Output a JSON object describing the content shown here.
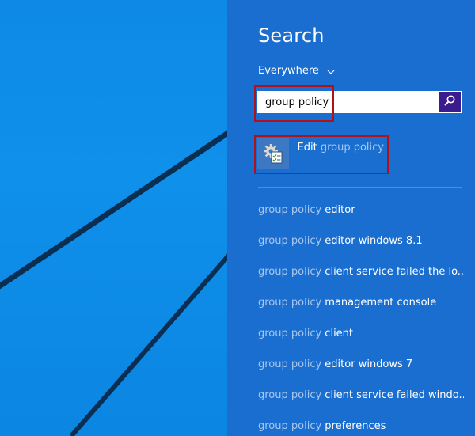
{
  "search_pane": {
    "title": "Search",
    "scope_label": "Everywhere",
    "query_value": "group policy",
    "app_result": {
      "prefix": "Edit ",
      "match": "group policy"
    },
    "suggestions": [
      {
        "match": "group policy",
        "rest": " editor"
      },
      {
        "match": "group policy",
        "rest": " editor windows 8.1"
      },
      {
        "match": "group policy",
        "rest": " client service failed the lo..."
      },
      {
        "match": "group policy",
        "rest": " management console"
      },
      {
        "match": "group policy",
        "rest": " client"
      },
      {
        "match": "group policy",
        "rest": " editor windows 7"
      },
      {
        "match": "group policy",
        "rest": " client service failed windo..."
      },
      {
        "match": "group policy",
        "rest": " preferences"
      }
    ]
  },
  "icons": {
    "scope_dropdown": "chevron-down-icon",
    "search_button": "magnifier-icon",
    "app_result": "group-policy-editor-icon"
  },
  "colors": {
    "charm_background": "#1a6ed0",
    "desktop_background": "#0e8ae6",
    "search_button": "#3b1c8e",
    "highlight_outline": "#b01218",
    "dim_text": "#a9c7ee",
    "bright_text": "#ffffff"
  }
}
